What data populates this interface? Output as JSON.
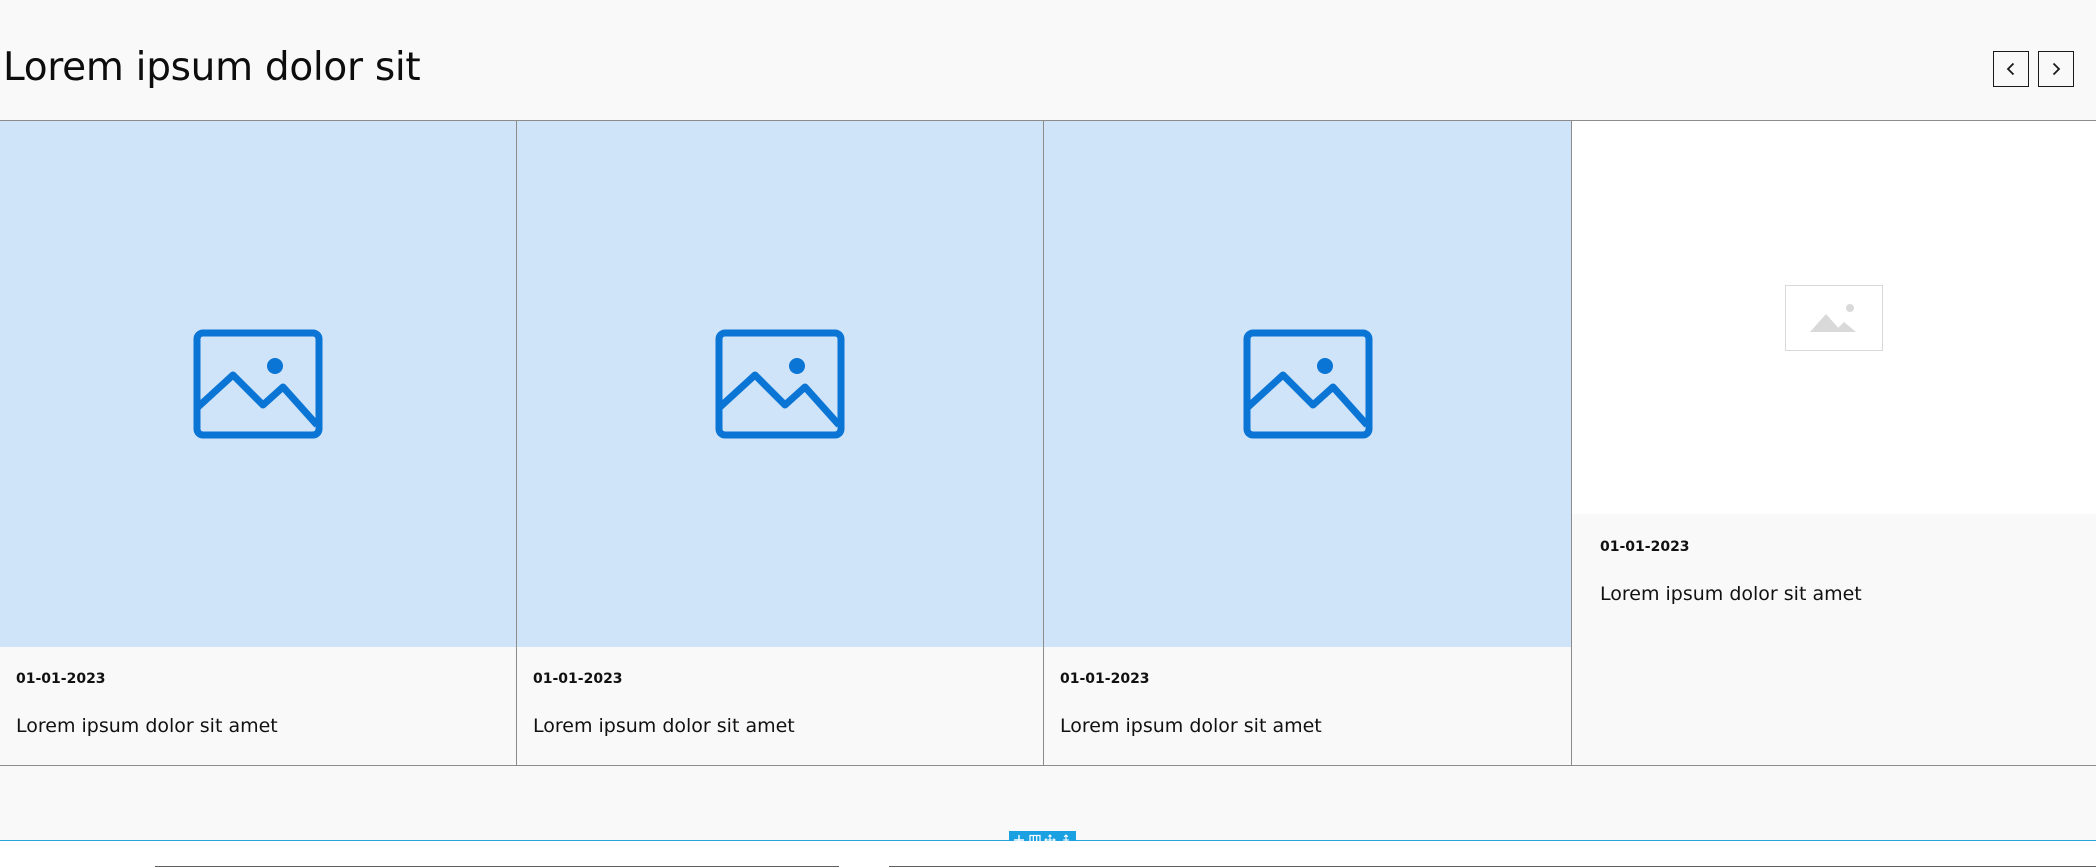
{
  "header": {
    "title": "Lorem ipsum dolor sit",
    "prev_icon": "chevron-left-icon",
    "next_icon": "chevron-right-icon"
  },
  "cards": [
    {
      "date": "01-01-2023",
      "title": "Lorem ipsum dolor sit amet",
      "image_icon": "image-icon"
    },
    {
      "date": "01-01-2023",
      "title": "Lorem ipsum dolor sit amet",
      "image_icon": "image-icon"
    },
    {
      "date": "01-01-2023",
      "title": "Lorem ipsum dolor sit amet",
      "image_icon": "image-icon"
    },
    {
      "date": "01-01-2023",
      "title": "Lorem ipsum dolor sit amet",
      "image_icon": "image-placeholder-icon"
    }
  ],
  "section_toolbar": {
    "icons": [
      "add-icon",
      "columns-icon",
      "move-icon",
      "resize-icon"
    ]
  },
  "colors": {
    "background": "#f9f9f9",
    "image_fill": "#cfe4f8",
    "image_icon": "#0b75d6",
    "placeholder_icon": "#d9d9d9",
    "divider": "#8c8c8c",
    "editor_accent": "#1ba1e2"
  }
}
